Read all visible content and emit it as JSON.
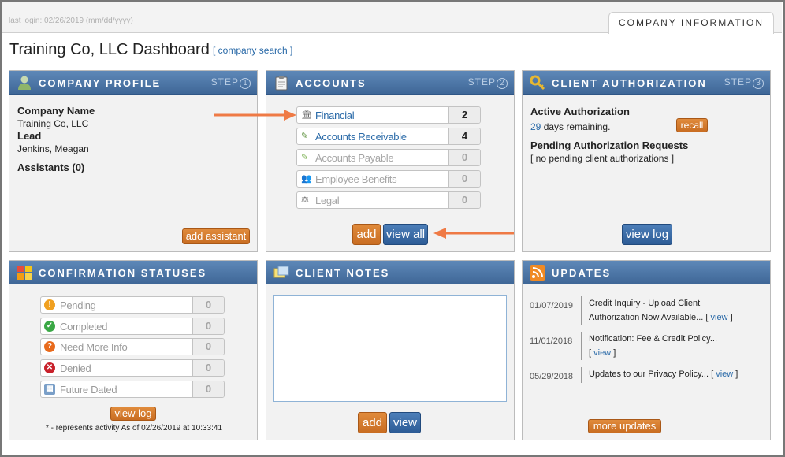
{
  "header": {
    "last_login": "last login: 02/26/2019 (mm/dd/yyyy)",
    "tab": "COMPANY INFORMATION"
  },
  "page": {
    "title": "Training Co, LLC Dashboard",
    "search_link": "[ company search ]"
  },
  "profile": {
    "title": "COMPANY PROFILE",
    "step_label": "STEP",
    "step_num": "1",
    "company_name_label": "Company Name",
    "company_name": "Training Co, LLC",
    "lead_label": "Lead",
    "lead": "Jenkins, Meagan",
    "assistants_label": "Assistants (0)",
    "add_assistant": "add assistant"
  },
  "accounts": {
    "title": "ACCOUNTS",
    "step_label": "STEP",
    "step_num": "2",
    "rows": [
      {
        "label": "Financial",
        "count": "2",
        "icon": "bank-icon"
      },
      {
        "label": "Accounts Receivable",
        "count": "4",
        "icon": "receivable-icon"
      },
      {
        "label": "Accounts Payable",
        "count": "0",
        "icon": "payable-icon"
      },
      {
        "label": "Employee Benefits",
        "count": "0",
        "icon": "people-icon"
      },
      {
        "label": "Legal",
        "count": "0",
        "icon": "scales-icon"
      }
    ],
    "add": "add",
    "view_all": "view all"
  },
  "authorization": {
    "title": "CLIENT AUTHORIZATION",
    "step_label": "STEP",
    "step_num": "3",
    "active_label": "Active Authorization",
    "days": "29",
    "days_suffix": "days remaining.",
    "recall": "recall",
    "pending_label": "Pending Authorization Requests",
    "pending_text": "[ no pending client authorizations ]",
    "view_log": "view log"
  },
  "statuses": {
    "title": "CONFIRMATION STATUSES",
    "rows": [
      {
        "label": "Pending",
        "count": "0",
        "color": "#f0a020",
        "glyph": "!"
      },
      {
        "label": "Completed",
        "count": "0",
        "color": "#3aa845",
        "glyph": "✓"
      },
      {
        "label": "Need More Info",
        "count": "0",
        "color": "#e86a1c",
        "glyph": "?"
      },
      {
        "label": "Denied",
        "count": "0",
        "color": "#c8202a",
        "glyph": "✕"
      },
      {
        "label": "Future Dated",
        "count": "0",
        "color": "#7a9fc8",
        "glyph": "▦"
      }
    ],
    "view_log": "view log",
    "footnote": "* - represents activity As of 02/26/2019 at 10:33:41"
  },
  "notes": {
    "title": "CLIENT NOTES",
    "add": "add",
    "view": "view"
  },
  "updates": {
    "title": "UPDATES",
    "items": [
      {
        "date": "01/07/2019",
        "line1": "Credit Inquiry - Upload Client",
        "line2": "Authorization Now Available...",
        "link": "view"
      },
      {
        "date": "11/01/2018",
        "line1": "Notification: Fee & Credit Policy...",
        "line2": "",
        "link": "view"
      },
      {
        "date": "05/29/2018",
        "line1": "Updates to our Privacy Policy...",
        "line2": "",
        "link": "view"
      }
    ],
    "more": "more updates"
  },
  "colors": {
    "panel_header": "#4a74a6",
    "orange_button": "#d57b2c",
    "blue_button": "#3a6aa4",
    "link": "#2a6aa8",
    "arrow": "#ef7a45"
  }
}
